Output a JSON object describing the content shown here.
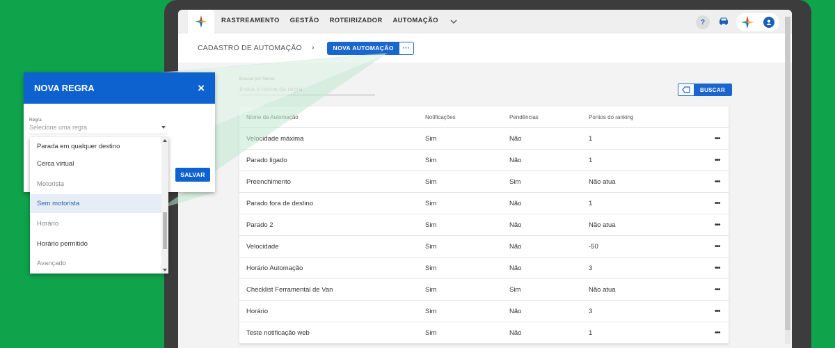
{
  "colors": {
    "background": "#0fa34c",
    "primary": "#0d62d0",
    "accent_blue": "#1a66cc"
  },
  "topnav": {
    "items": [
      "RASTREAMENTO",
      "GESTÃO",
      "ROTEIRIZADOR",
      "AUTOMAÇÃO"
    ],
    "more_icon": "chevron-down-icon",
    "help_label": "?",
    "icons": [
      "help-icon",
      "car-icon",
      "logo-icon",
      "user-icon"
    ]
  },
  "breadcrumb": {
    "title": "CADASTRO DE AUTOMAÇÃO",
    "separator": "›",
    "new_button": "NOVA AUTOMAÇÃO",
    "more": "···"
  },
  "search": {
    "label": "Buscar por Nome",
    "placeholder": "Insira o nome da regra",
    "button": "BUSCAR"
  },
  "table": {
    "columns": [
      "Nome da Automação",
      "Notificações",
      "Pendências",
      "Pontos do ranking"
    ],
    "rows": [
      [
        "Velocidade máxima",
        "Sim",
        "Não",
        "1"
      ],
      [
        "Parado ligado",
        "Sim",
        "Não",
        "1"
      ],
      [
        "Preenchimento",
        "Sim",
        "Sim",
        "Não atua"
      ],
      [
        "Parado fora de destino",
        "Sim",
        "Não",
        "1"
      ],
      [
        "Parado 2",
        "Sim",
        "Não",
        "Não atua"
      ],
      [
        "Velocidade",
        "Sim",
        "Não",
        "-50"
      ],
      [
        "Horário Automação",
        "Sim",
        "Não",
        "3"
      ],
      [
        "Checklist Ferramental de Van",
        "Sim",
        "Sim",
        "Não atua"
      ],
      [
        "Horário",
        "Sim",
        "Não",
        "3"
      ],
      [
        "Teste notificação web",
        "Sim",
        "Não",
        "1"
      ]
    ],
    "row_menu": "•••"
  },
  "dialog": {
    "title": "NOVA REGRA",
    "close": "×",
    "field_label": "Regra",
    "field_placeholder": "Selecione uma regra",
    "save": "SALVAR"
  },
  "dropdown": {
    "options": [
      {
        "label": "Parada em qualquer destino",
        "state": "normal"
      },
      {
        "label": "Cerca virtual",
        "state": "normal"
      },
      {
        "label": "Motorista",
        "state": "muted"
      },
      {
        "label": "Sem motorista",
        "state": "selected"
      },
      {
        "label": "Horário",
        "state": "muted"
      },
      {
        "label": "Horário permitido",
        "state": "normal"
      },
      {
        "label": "Avançado",
        "state": "muted"
      }
    ]
  }
}
